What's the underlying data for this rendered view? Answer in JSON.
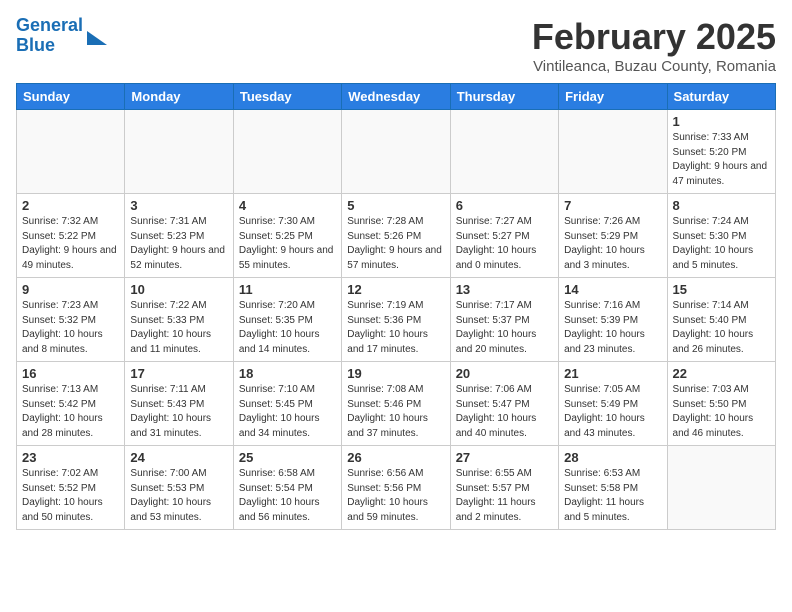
{
  "header": {
    "logo_line1": "General",
    "logo_line2": "Blue",
    "month": "February 2025",
    "location": "Vintileanca, Buzau County, Romania"
  },
  "days_of_week": [
    "Sunday",
    "Monday",
    "Tuesday",
    "Wednesday",
    "Thursday",
    "Friday",
    "Saturday"
  ],
  "weeks": [
    [
      {
        "day": "",
        "info": ""
      },
      {
        "day": "",
        "info": ""
      },
      {
        "day": "",
        "info": ""
      },
      {
        "day": "",
        "info": ""
      },
      {
        "day": "",
        "info": ""
      },
      {
        "day": "",
        "info": ""
      },
      {
        "day": "1",
        "info": "Sunrise: 7:33 AM\nSunset: 5:20 PM\nDaylight: 9 hours and 47 minutes."
      }
    ],
    [
      {
        "day": "2",
        "info": "Sunrise: 7:32 AM\nSunset: 5:22 PM\nDaylight: 9 hours and 49 minutes."
      },
      {
        "day": "3",
        "info": "Sunrise: 7:31 AM\nSunset: 5:23 PM\nDaylight: 9 hours and 52 minutes."
      },
      {
        "day": "4",
        "info": "Sunrise: 7:30 AM\nSunset: 5:25 PM\nDaylight: 9 hours and 55 minutes."
      },
      {
        "day": "5",
        "info": "Sunrise: 7:28 AM\nSunset: 5:26 PM\nDaylight: 9 hours and 57 minutes."
      },
      {
        "day": "6",
        "info": "Sunrise: 7:27 AM\nSunset: 5:27 PM\nDaylight: 10 hours and 0 minutes."
      },
      {
        "day": "7",
        "info": "Sunrise: 7:26 AM\nSunset: 5:29 PM\nDaylight: 10 hours and 3 minutes."
      },
      {
        "day": "8",
        "info": "Sunrise: 7:24 AM\nSunset: 5:30 PM\nDaylight: 10 hours and 5 minutes."
      }
    ],
    [
      {
        "day": "9",
        "info": "Sunrise: 7:23 AM\nSunset: 5:32 PM\nDaylight: 10 hours and 8 minutes."
      },
      {
        "day": "10",
        "info": "Sunrise: 7:22 AM\nSunset: 5:33 PM\nDaylight: 10 hours and 11 minutes."
      },
      {
        "day": "11",
        "info": "Sunrise: 7:20 AM\nSunset: 5:35 PM\nDaylight: 10 hours and 14 minutes."
      },
      {
        "day": "12",
        "info": "Sunrise: 7:19 AM\nSunset: 5:36 PM\nDaylight: 10 hours and 17 minutes."
      },
      {
        "day": "13",
        "info": "Sunrise: 7:17 AM\nSunset: 5:37 PM\nDaylight: 10 hours and 20 minutes."
      },
      {
        "day": "14",
        "info": "Sunrise: 7:16 AM\nSunset: 5:39 PM\nDaylight: 10 hours and 23 minutes."
      },
      {
        "day": "15",
        "info": "Sunrise: 7:14 AM\nSunset: 5:40 PM\nDaylight: 10 hours and 26 minutes."
      }
    ],
    [
      {
        "day": "16",
        "info": "Sunrise: 7:13 AM\nSunset: 5:42 PM\nDaylight: 10 hours and 28 minutes."
      },
      {
        "day": "17",
        "info": "Sunrise: 7:11 AM\nSunset: 5:43 PM\nDaylight: 10 hours and 31 minutes."
      },
      {
        "day": "18",
        "info": "Sunrise: 7:10 AM\nSunset: 5:45 PM\nDaylight: 10 hours and 34 minutes."
      },
      {
        "day": "19",
        "info": "Sunrise: 7:08 AM\nSunset: 5:46 PM\nDaylight: 10 hours and 37 minutes."
      },
      {
        "day": "20",
        "info": "Sunrise: 7:06 AM\nSunset: 5:47 PM\nDaylight: 10 hours and 40 minutes."
      },
      {
        "day": "21",
        "info": "Sunrise: 7:05 AM\nSunset: 5:49 PM\nDaylight: 10 hours and 43 minutes."
      },
      {
        "day": "22",
        "info": "Sunrise: 7:03 AM\nSunset: 5:50 PM\nDaylight: 10 hours and 46 minutes."
      }
    ],
    [
      {
        "day": "23",
        "info": "Sunrise: 7:02 AM\nSunset: 5:52 PM\nDaylight: 10 hours and 50 minutes."
      },
      {
        "day": "24",
        "info": "Sunrise: 7:00 AM\nSunset: 5:53 PM\nDaylight: 10 hours and 53 minutes."
      },
      {
        "day": "25",
        "info": "Sunrise: 6:58 AM\nSunset: 5:54 PM\nDaylight: 10 hours and 56 minutes."
      },
      {
        "day": "26",
        "info": "Sunrise: 6:56 AM\nSunset: 5:56 PM\nDaylight: 10 hours and 59 minutes."
      },
      {
        "day": "27",
        "info": "Sunrise: 6:55 AM\nSunset: 5:57 PM\nDaylight: 11 hours and 2 minutes."
      },
      {
        "day": "28",
        "info": "Sunrise: 6:53 AM\nSunset: 5:58 PM\nDaylight: 11 hours and 5 minutes."
      },
      {
        "day": "",
        "info": ""
      }
    ]
  ]
}
